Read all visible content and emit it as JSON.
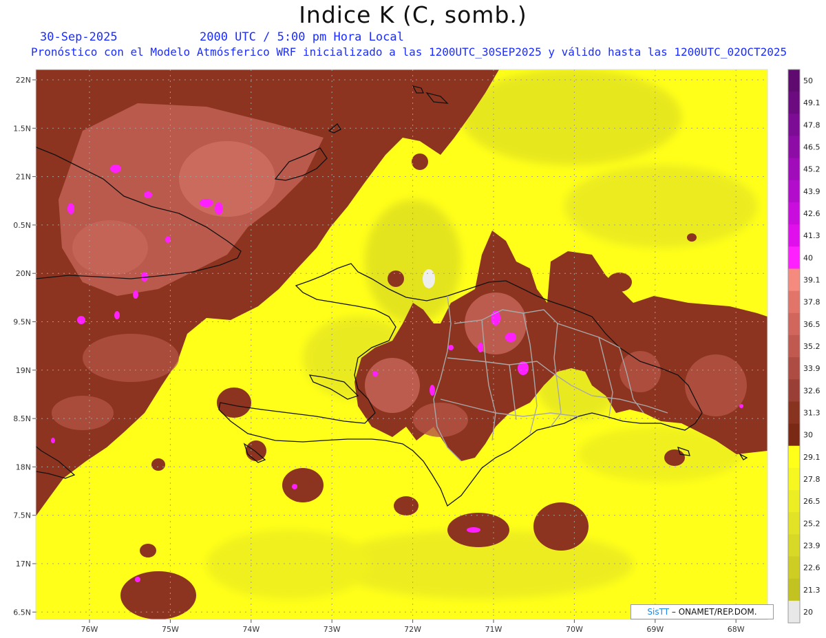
{
  "title": "Indice K (C, somb.)",
  "header": {
    "date": "30-Sep-2025",
    "valid_time": "2000 UTC / 5:00 pm Hora Local",
    "forecast_note": "Pronóstico con el Modelo Atmósferico WRF inicializado a las 1200UTC_30SEP2025 y válido hasta las  1200UTC_02OCT2025"
  },
  "axes": {
    "lat_labels": [
      "22N",
      "1.5N",
      "21N",
      "0.5N",
      "20N",
      "9.5N",
      "19N",
      "8.5N",
      "18N",
      "7.5N",
      "17N",
      "6.5N"
    ],
    "lon_labels": [
      "76W",
      "75W",
      "74W",
      "73W",
      "72W",
      "71W",
      "70W",
      "69W",
      "68W"
    ]
  },
  "colorbar": {
    "labels": [
      "50",
      "49.1",
      "47.8",
      "46.5",
      "45.2",
      "43.9",
      "42.6",
      "41.3",
      "40",
      "39.1",
      "37.8",
      "36.5",
      "35.2",
      "33.9",
      "32.6",
      "31.3",
      "30",
      "29.1",
      "27.8",
      "26.5",
      "25.2",
      "23.9",
      "22.6",
      "21.3",
      "20"
    ],
    "colors": [
      "#5e0a6e",
      "#6c0b80",
      "#7c0c93",
      "#8e0ca6",
      "#a00cba",
      "#b30dcc",
      "#c80ddc",
      "#e010ec",
      "#ff20ff",
      "#f58a7e",
      "#e2756a",
      "#d0665c",
      "#c05a50",
      "#ad4c42",
      "#9a3f35",
      "#88331f",
      "#7a2a14",
      "#ffff1a",
      "#f6f620",
      "#eded24",
      "#e2e226",
      "#d8d826",
      "#cdcd24",
      "#c2c220",
      "#e8e8e8"
    ]
  },
  "credit": {
    "brand": "SisTT",
    "org": "– ONAMET/REP.DOM."
  }
}
